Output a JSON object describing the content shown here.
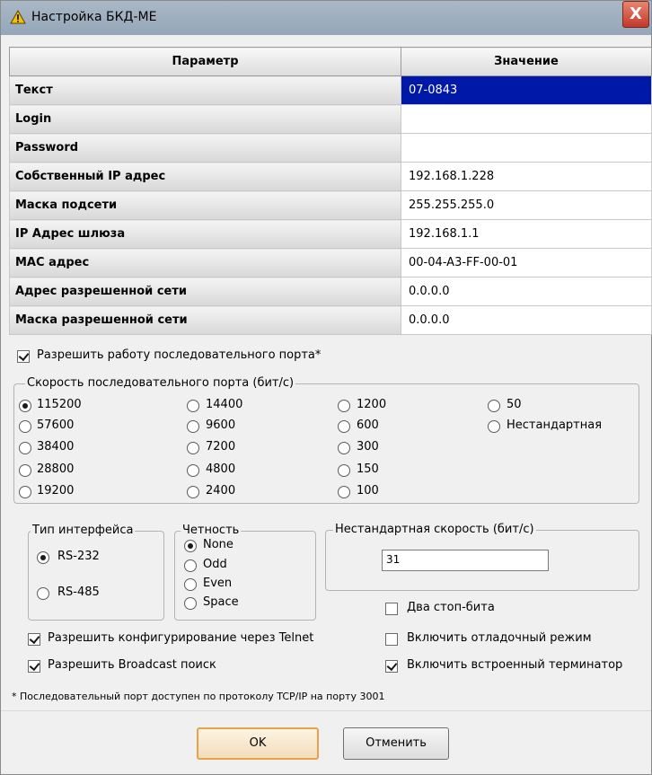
{
  "window": {
    "title": "Настройка БКД-МЕ",
    "close": "X"
  },
  "grid": {
    "col_param": "Параметр",
    "col_value": "Значение",
    "rows": [
      {
        "param": "Текст",
        "value": "07-0843"
      },
      {
        "param": "Login",
        "value": ""
      },
      {
        "param": "Password",
        "value": ""
      },
      {
        "param": "Собственный IP адрес",
        "value": "192.168.1.228"
      },
      {
        "param": "Маска подсети",
        "value": "255.255.255.0"
      },
      {
        "param": "IP Адрес шлюза",
        "value": "192.168.1.1"
      },
      {
        "param": "MAC адрес",
        "value": "00-04-A3-FF-00-01"
      },
      {
        "param": "Адрес разрешенной сети",
        "value": "0.0.0.0"
      },
      {
        "param": "Маска разрешенной сети",
        "value": "0.0.0.0"
      }
    ]
  },
  "serial_enable": {
    "label": "Разрешить работу последовательного порта*",
    "checked": true
  },
  "baud": {
    "title": "Скорость последовательного порта (бит/с)",
    "options": [
      "115200",
      "57600",
      "38400",
      "28800",
      "19200",
      "14400",
      "9600",
      "7200",
      "4800",
      "2400",
      "1200",
      "600",
      "300",
      "150",
      "100",
      "50",
      "Нестандартная"
    ],
    "selected": "115200"
  },
  "interface": {
    "title": "Тип интерфейса",
    "options": [
      "RS-232",
      "RS-485"
    ],
    "selected": "RS-232"
  },
  "parity": {
    "title": "Четность",
    "options": [
      "None",
      "Odd",
      "Even",
      "Space"
    ],
    "selected": "None"
  },
  "custom_speed": {
    "title": "Нестандартная скорость (бит/с)",
    "value": "31"
  },
  "checks": {
    "two_stop": {
      "label": "Два стоп-бита",
      "checked": false
    },
    "telnet": {
      "label": "Разрешить конфигурирование через Telnet",
      "checked": true
    },
    "debug": {
      "label": "Включить отладочный режим",
      "checked": false
    },
    "broadcast": {
      "label": "Разрешить Broadcast поиск",
      "checked": true
    },
    "terminator": {
      "label": "Включить встроенный терминатор",
      "checked": true
    }
  },
  "note": "* Последовательный порт доступен по протоколу TCP/IP на порту 3001",
  "buttons": {
    "ok": "OK",
    "cancel": "Отменить"
  },
  "colors": {
    "selection": "#0018a8",
    "default_button": "#e8a24a",
    "warning_icon": "#f2c200"
  }
}
